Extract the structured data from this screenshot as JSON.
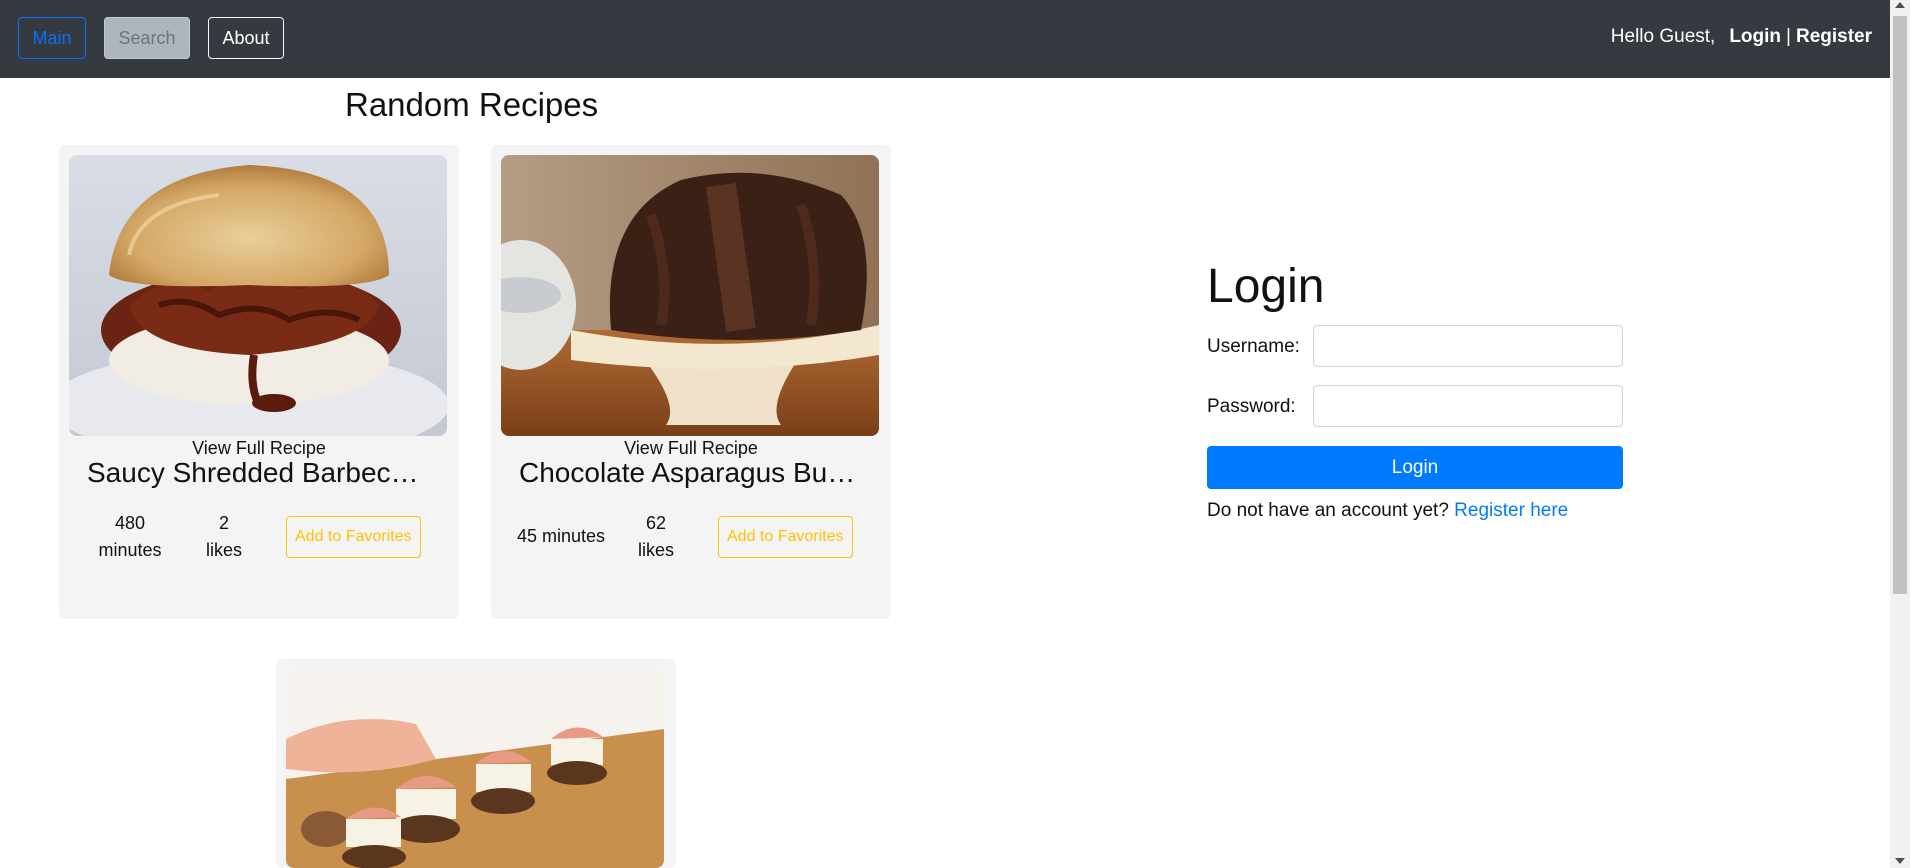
{
  "nav": {
    "main_label": "Main",
    "search_label": "Search",
    "about_label": "About",
    "greeting": "Hello Guest,",
    "login_label": "Login",
    "separator": "|",
    "register_label": "Register"
  },
  "recipes_section": {
    "title": "Random Recipes",
    "cards": [
      {
        "view_label": "View Full Recipe",
        "title": "Saucy Shredded Barbecue Sandwiches",
        "time_value": "480",
        "time_unit": "minutes",
        "likes_value": "2",
        "likes_unit": "likes",
        "favorite_label": "Add to Favorites",
        "image_icon": "pulled-pork-sandwich-image"
      },
      {
        "view_label": "View Full Recipe",
        "title": "Chocolate Asparagus Bundt Cake",
        "time_value": "45 minutes",
        "likes_value": "62",
        "likes_unit": "likes",
        "favorite_label": "Add to Favorites",
        "image_icon": "chocolate-bundt-cake-image"
      },
      {
        "image_icon": "prosciutto-appetizer-image"
      }
    ]
  },
  "login_form": {
    "title": "Login",
    "username_label": "Username:",
    "password_label": "Password:",
    "username_value": "",
    "password_value": "",
    "submit_label": "Login",
    "register_prompt": "Do not have an account yet?",
    "register_link": "Register here"
  },
  "colors": {
    "navbar_bg": "#343a40",
    "primary": "#007bff",
    "favorite_outline": "#ffc107",
    "card_bg": "#f4f4f4"
  }
}
